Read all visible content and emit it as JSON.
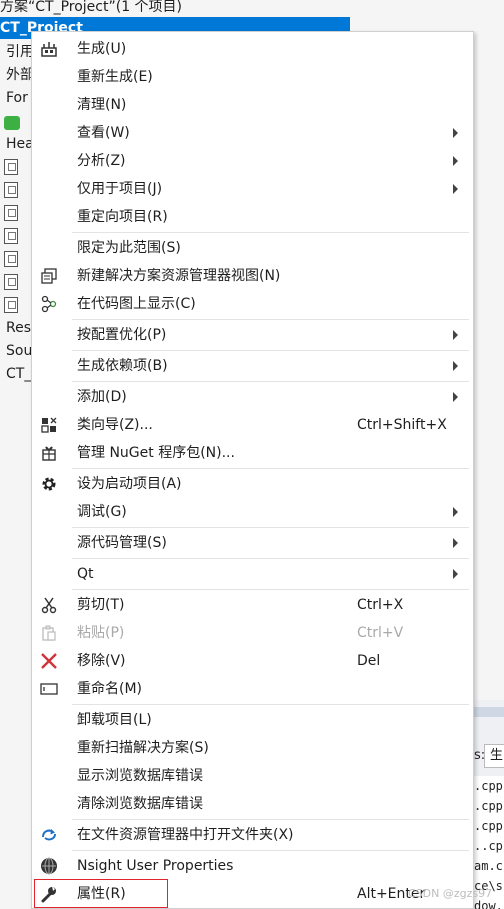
{
  "solution_explorer": {
    "solution_title": "方案“CT_Project”(1 个项目)",
    "project_name": "CT_Project",
    "items": [
      "引用",
      "外部",
      "For",
      "Hea",
      "Res",
      "Sou",
      "CT_"
    ]
  },
  "right_panel": {
    "input_label": "s:",
    "input_value": "生",
    "code_lines": [
      ".cpp",
      ".cpp",
      ".cpp",
      "..cpp",
      "am.c",
      "ce\\s",
      "dow."
    ]
  },
  "context_menu": {
    "items": [
      {
        "label": "生成(U)",
        "icon": "build-icon"
      },
      {
        "label": "重新生成(E)"
      },
      {
        "label": "清理(N)"
      },
      {
        "label": "查看(W)",
        "submenu": true
      },
      {
        "label": "分析(Z)",
        "submenu": true
      },
      {
        "label": "仅用于项目(J)",
        "submenu": true
      },
      {
        "label": "重定向项目(R)"
      },
      {
        "label": "限定为此范围(S)"
      },
      {
        "label": "新建解决方案资源管理器视图(N)",
        "icon": "new-view-icon"
      },
      {
        "label": "在代码图上显示(C)",
        "icon": "code-map-icon"
      },
      {
        "label": "按配置优化(P)",
        "submenu": true
      },
      {
        "label": "生成依赖项(B)",
        "submenu": true
      },
      {
        "label": "添加(D)",
        "submenu": true
      },
      {
        "label": "类向导(Z)...",
        "shortcut": "Ctrl+Shift+X",
        "icon": "class-wizard-icon"
      },
      {
        "label": "管理 NuGet 程序包(N)...",
        "icon": "nuget-icon"
      },
      {
        "label": "设为启动项目(A)",
        "icon": "gear-icon"
      },
      {
        "label": "调试(G)",
        "submenu": true
      },
      {
        "label": "源代码管理(S)",
        "submenu": true
      },
      {
        "label": "Qt",
        "submenu": true
      },
      {
        "label": "剪切(T)",
        "shortcut": "Ctrl+X",
        "icon": "scissors-icon"
      },
      {
        "label": "粘贴(P)",
        "shortcut": "Ctrl+V",
        "icon": "paste-icon",
        "disabled": true
      },
      {
        "label": "移除(V)",
        "shortcut": "Del",
        "icon": "remove-icon"
      },
      {
        "label": "重命名(M)",
        "icon": "rename-icon"
      },
      {
        "label": "卸载项目(L)"
      },
      {
        "label": "重新扫描解决方案(S)"
      },
      {
        "label": "显示浏览数据库错误"
      },
      {
        "label": "清除浏览数据库错误"
      },
      {
        "label": "在文件资源管理器中打开文件夹(X)",
        "icon": "open-folder-refresh-icon"
      },
      {
        "label": "Nsight User Properties",
        "icon": "nsight-icon"
      },
      {
        "label": "属性(R)",
        "shortcut": "Alt+Enter",
        "icon": "wrench-icon"
      }
    ]
  },
  "watermark": "CSDN @zgzs97",
  "colors": {
    "selection": "#0078d7",
    "highlight_border": "#e0242b",
    "remove_x": "#d13438",
    "refresh_arrow": "#1e6fc6"
  }
}
